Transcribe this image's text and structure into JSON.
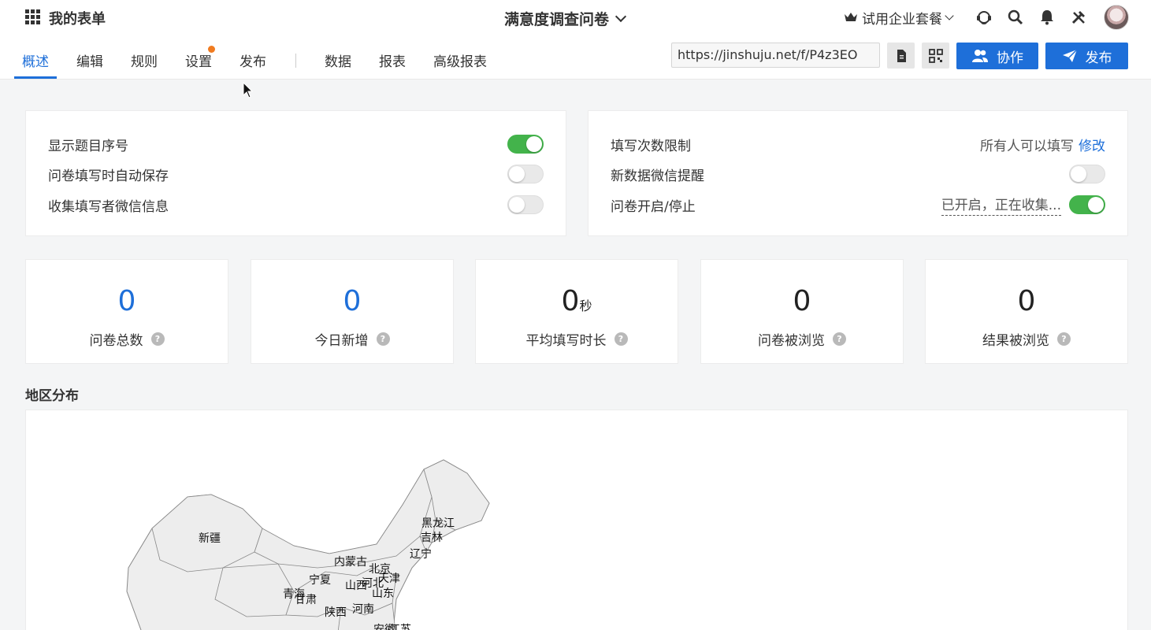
{
  "header": {
    "app_title": "我的表单",
    "form_title": "满意度调查问卷",
    "plan_label": "试用企业套餐"
  },
  "tabs": [
    {
      "label": "概述",
      "active": true
    },
    {
      "label": "编辑"
    },
    {
      "label": "规则"
    },
    {
      "label": "设置",
      "badge": true
    },
    {
      "label": "发布"
    },
    {
      "label": "数据"
    },
    {
      "label": "报表"
    },
    {
      "label": "高级报表"
    }
  ],
  "share": {
    "url": "https://jinshuju.net/f/P4z3EO",
    "collaborate_label": "协作",
    "publish_label": "发布"
  },
  "settings_left": [
    {
      "label": "显示题目序号",
      "on": true
    },
    {
      "label": "问卷填写时自动保存",
      "on": false
    },
    {
      "label": "收集填写者微信信息",
      "on": false
    }
  ],
  "settings_right": {
    "fill_limit_label": "填写次数限制",
    "fill_limit_value": "所有人可以填写",
    "fill_limit_action": "修改",
    "wechat_remind_label": "新数据微信提醒",
    "open_stop_label": "问卷开启/停止",
    "open_stop_status": "已开启，正在收集..."
  },
  "stats": [
    {
      "value": "0",
      "unit": "",
      "label": "问卷总数",
      "highlight": true
    },
    {
      "value": "0",
      "unit": "",
      "label": "今日新增",
      "highlight": true
    },
    {
      "value": "0",
      "unit": "秒",
      "label": "平均填写时长",
      "highlight": false
    },
    {
      "value": "0",
      "unit": "",
      "label": "问卷被浏览",
      "highlight": false
    },
    {
      "value": "0",
      "unit": "",
      "label": "结果被浏览",
      "highlight": false
    }
  ],
  "region": {
    "title": "地区分布",
    "provinces": [
      "黑龙江",
      "吉林",
      "辽宁",
      "新疆",
      "内蒙古",
      "北京",
      "天津",
      "宁夏",
      "山西",
      "河北",
      "山东",
      "青海",
      "甘肃",
      "陕西",
      "河南",
      "安徽",
      "江苏"
    ]
  },
  "colors": {
    "accent": "#1e6fd9",
    "toggle_on": "#43b34b",
    "badge": "#f07b20"
  },
  "help_glyph": "?"
}
